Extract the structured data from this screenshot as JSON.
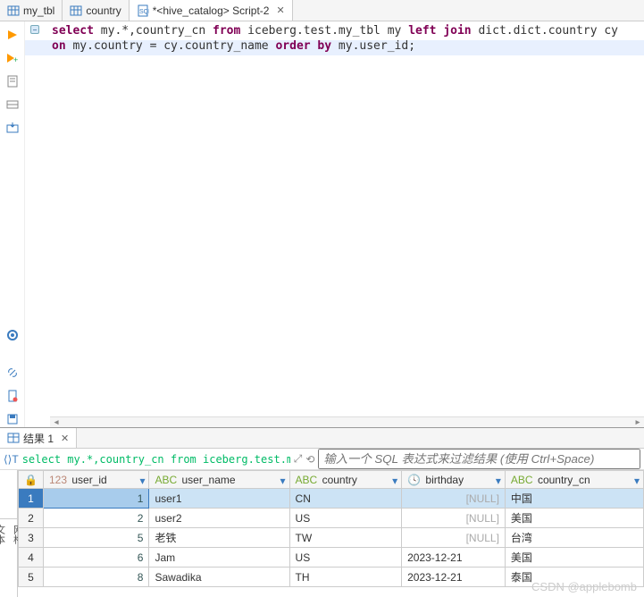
{
  "tabs": [
    {
      "label": "my_tbl"
    },
    {
      "label": "country"
    },
    {
      "label": "*<hive_catalog> Script-2",
      "active": true
    }
  ],
  "sql": {
    "line1_pre": "select ",
    "line1_expr": "my.*,country_cn ",
    "line1_from": "from ",
    "line1_tbl": "iceberg.test.my_tbl my ",
    "line1_join": "left join ",
    "line1_rhs": "dict.dict.country cy",
    "line2_pre": "on ",
    "line2_cond": "my.country = cy.country_name ",
    "line2_ord": "order by ",
    "line2_col": "my.user_id;"
  },
  "results_tab": "结果 1",
  "filter_sql": "select my.*,country_cn from iceberg.test.my_tbl my le",
  "filter_placeholder": "输入一个 SQL 表达式来过滤结果 (使用 Ctrl+Space)",
  "columns": [
    {
      "name": "user_id",
      "type": "num"
    },
    {
      "name": "user_name",
      "type": "str"
    },
    {
      "name": "country",
      "type": "str"
    },
    {
      "name": "birthday",
      "type": "date"
    },
    {
      "name": "country_cn",
      "type": "str"
    }
  ],
  "rows": [
    {
      "n": "1",
      "user_id": "1",
      "user_name": "user1",
      "country": "CN",
      "birthday": "[NULL]",
      "country_cn": "中国",
      "bnull": true
    },
    {
      "n": "2",
      "user_id": "2",
      "user_name": "user2",
      "country": "US",
      "birthday": "[NULL]",
      "country_cn": "美国",
      "bnull": true
    },
    {
      "n": "3",
      "user_id": "5",
      "user_name": "老铁",
      "country": "TW",
      "birthday": "[NULL]",
      "country_cn": "台湾",
      "bnull": true
    },
    {
      "n": "4",
      "user_id": "6",
      "user_name": "Jam",
      "country": "US",
      "birthday": "2023-12-21",
      "country_cn": "美国",
      "bnull": false
    },
    {
      "n": "5",
      "user_id": "8",
      "user_name": "Sawadika",
      "country": "TH",
      "birthday": "2023-12-21",
      "country_cn": "泰国",
      "bnull": false
    }
  ],
  "vtabs": {
    "t1": "网格",
    "t2": "文本"
  },
  "watermark": "CSDN @applebomb",
  "type_prefix": {
    "num": "123",
    "str": "ABC",
    "date": ""
  }
}
